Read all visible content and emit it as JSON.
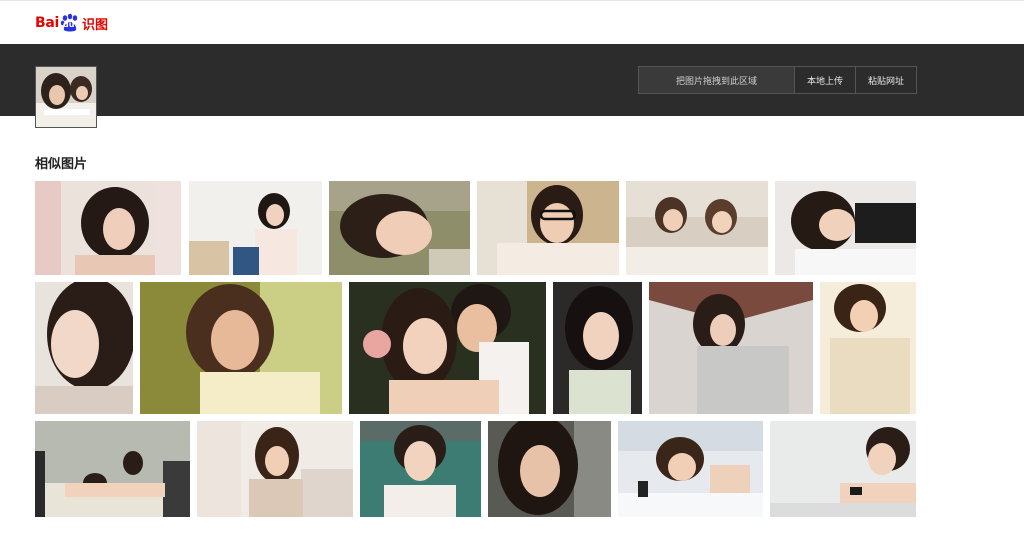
{
  "brand": {
    "logo_text_left": "Bai",
    "logo_text_paw": "du",
    "logo_text_right": "识图",
    "logo_color": "#e10602"
  },
  "search": {
    "drop_zone_label": "把图片拖拽到此区域",
    "upload_label": "本地上传",
    "paste_label": "粘贴网址"
  },
  "results": {
    "section_title": "相似图片"
  },
  "colors": {
    "band": "#2c2c2c",
    "accent": "#e10602"
  }
}
